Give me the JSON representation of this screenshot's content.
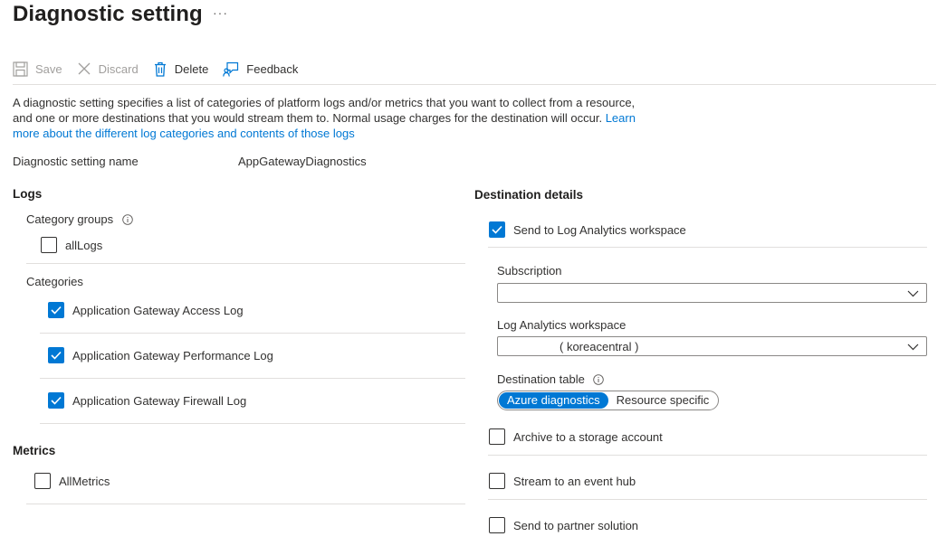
{
  "header": {
    "title": "Diagnostic setting",
    "more": "···"
  },
  "toolbar": {
    "save": "Save",
    "discard": "Discard",
    "delete": "Delete",
    "feedback": "Feedback"
  },
  "description": {
    "text": "A diagnostic setting specifies a list of categories of platform logs and/or metrics that you want to collect from a resource, and one or more destinations that you would stream them to. Normal usage charges for the destination will occur.",
    "link_text": "Learn more about the different log categories and contents of those logs"
  },
  "setting": {
    "label": "Diagnostic setting name",
    "value": "AppGatewayDiagnostics"
  },
  "logs": {
    "heading": "Logs",
    "category_groups_label": "Category groups",
    "groups": [
      {
        "label": "allLogs",
        "checked": false
      }
    ],
    "categories_label": "Categories",
    "categories": [
      {
        "label": "Application Gateway Access Log",
        "checked": true
      },
      {
        "label": "Application Gateway Performance Log",
        "checked": true
      },
      {
        "label": "Application Gateway Firewall Log",
        "checked": true
      }
    ]
  },
  "metrics": {
    "heading": "Metrics",
    "items": [
      {
        "label": "AllMetrics",
        "checked": false
      }
    ]
  },
  "destination": {
    "heading": "Destination details",
    "send_log_analytics": {
      "label": "Send to Log Analytics workspace",
      "checked": true
    },
    "subscription": {
      "label": "Subscription",
      "value": ""
    },
    "workspace": {
      "label": "Log Analytics workspace",
      "value": "( koreacentral )"
    },
    "table": {
      "label": "Destination table",
      "options": [
        "Azure diagnostics",
        "Resource specific"
      ],
      "selected": "Azure diagnostics"
    },
    "archive": {
      "label": "Archive to a storage account",
      "checked": false
    },
    "event_hub": {
      "label": "Stream to an event hub",
      "checked": false
    },
    "partner": {
      "label": "Send to partner solution",
      "checked": false
    }
  },
  "colors": {
    "accent": "#0078d4",
    "text": "#323130",
    "disabled": "#a19f9d",
    "divider": "#e1dfdd"
  }
}
